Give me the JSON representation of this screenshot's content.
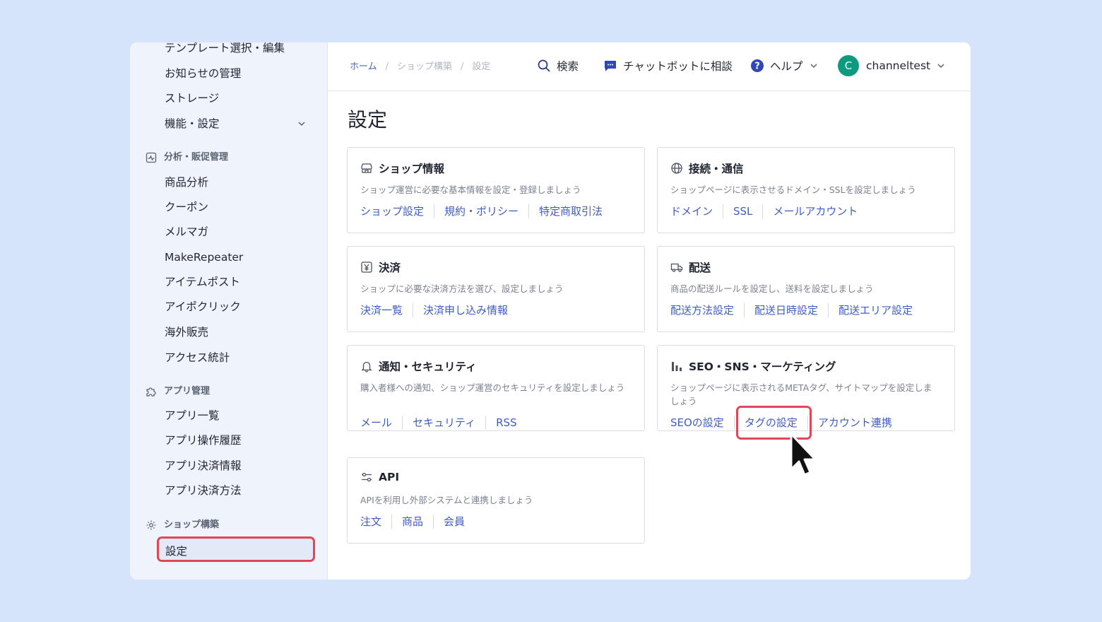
{
  "sidebar": {
    "items_top": [
      "テンプレート選択・編集",
      "お知らせの管理",
      "ストレージ",
      "機能・設定"
    ],
    "section_analytics": "分析・販促管理",
    "analytics_items": [
      "商品分析",
      "クーポン",
      "メルマガ",
      "MakeRepeater",
      "アイテムポスト",
      "アイポクリック",
      "海外販売",
      "アクセス統計"
    ],
    "section_apps": "アプリ管理",
    "app_items": [
      "アプリ一覧",
      "アプリ操作履歴",
      "アプリ決済情報",
      "アプリ決済方法"
    ],
    "section_shop": "ショップ構築",
    "active_item": "設定"
  },
  "header": {
    "breadcrumb": [
      "ホーム",
      "ショップ構築",
      "設定"
    ],
    "search": "検索",
    "chatbot": "チャットボットに相談",
    "help": "ヘルプ",
    "avatar_initial": "C",
    "username": "channeltest"
  },
  "page_title": "設定",
  "cards": [
    {
      "title": "ショップ情報",
      "icon": "store-icon",
      "desc": "ショップ運営に必要な基本情報を設定・登録しましょう",
      "links": [
        "ショップ設定",
        "規約・ポリシー",
        "特定商取引法"
      ]
    },
    {
      "title": "接続・通信",
      "icon": "globe-icon",
      "desc": "ショップページに表示させるドメイン・SSLを設定しましょう",
      "links": [
        "ドメイン",
        "SSL",
        "メールアカウント"
      ]
    },
    {
      "title": "決済",
      "icon": "yen-icon",
      "desc": "ショップに必要な決済方法を選び、設定しましょう",
      "links": [
        "決済一覧",
        "決済申し込み情報"
      ]
    },
    {
      "title": "配送",
      "icon": "truck-icon",
      "desc": "商品の配送ルールを設定し、送料を設定しましょう",
      "links": [
        "配送方法設定",
        "配送日時設定",
        "配送エリア設定"
      ]
    },
    {
      "title": "通知・セキュリティ",
      "icon": "bell-icon",
      "desc": "購入者様への通知、ショップ運営のセキュリティを設定しましょう",
      "links": [
        "メール",
        "セキュリティ",
        "RSS"
      ]
    },
    {
      "title": "SEO・SNS・マーケティング",
      "icon": "bar-chart-icon",
      "desc": "ショップページに表示されるMETAタグ、サイトマップを設定しましょう",
      "links": [
        "SEOの設定",
        "タグの設定",
        "アカウント連携"
      ]
    },
    {
      "title": "API",
      "icon": "sliders-icon",
      "desc": "APIを利用し外部システムと連携しましょう",
      "links": [
        "注文",
        "商品",
        "会員"
      ]
    }
  ],
  "colors": {
    "accent": "#3f5cc4",
    "highlight": "#e0485a",
    "avatar": "#0e9a7f",
    "page_bg": "#d6e4fb"
  }
}
